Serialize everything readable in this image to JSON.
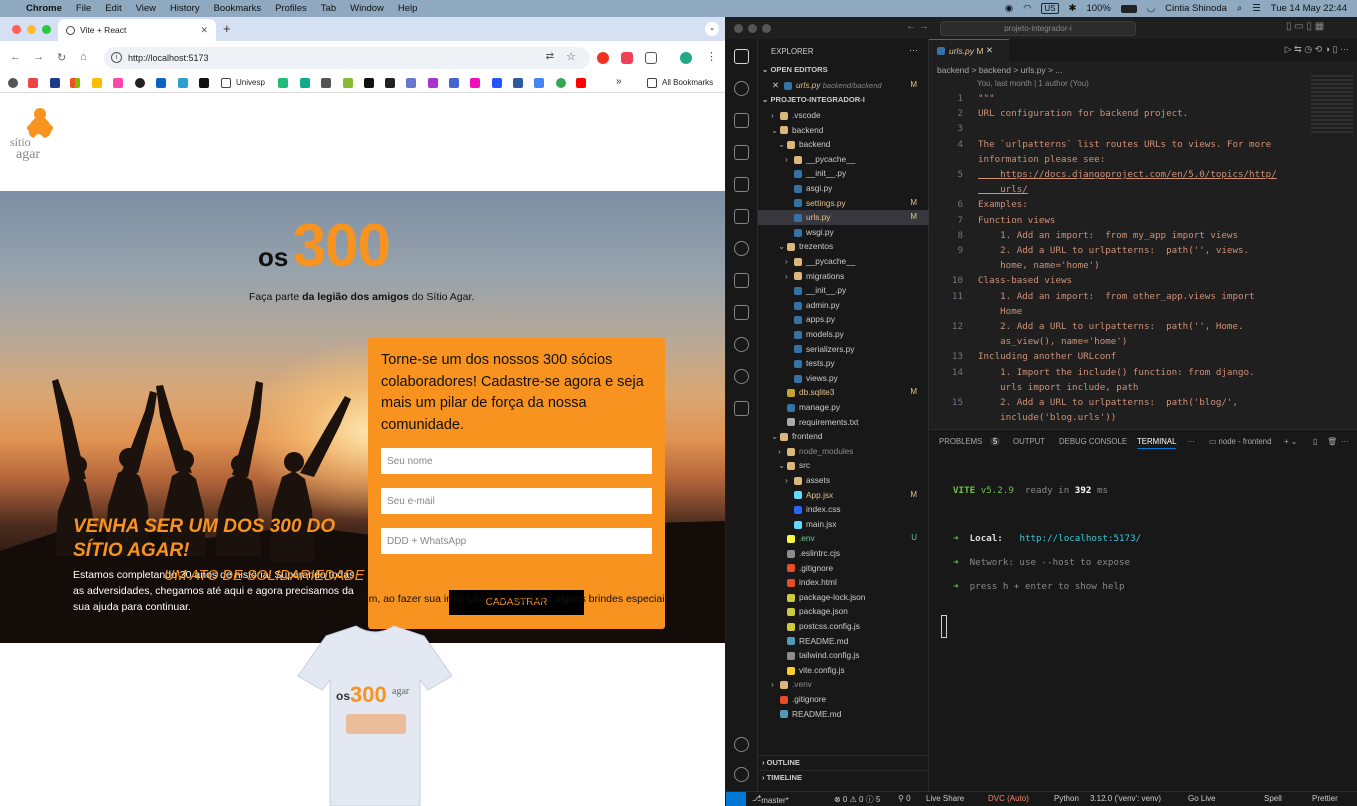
{
  "menubar": {
    "app": "Chrome",
    "items": [
      "File",
      "Edit",
      "View",
      "History",
      "Bookmarks",
      "Profiles",
      "Tab",
      "Window",
      "Help"
    ],
    "right": {
      "battery": "100%",
      "user": "Cintia Shinoda",
      "clock": "Tue 14 May  22:44",
      "input_source": "US"
    }
  },
  "browser": {
    "tab_title": "Vite + React",
    "url": "http://localhost:5173",
    "bookmarks": [
      "Univesp"
    ],
    "all_bookmarks": "All Bookmarks",
    "more": "»"
  },
  "site": {
    "logo_text": "sítio agar",
    "hero_os": "os",
    "hero_300": "300",
    "hero_sub_1": "Faça parte ",
    "hero_sub_bold": "da legião dos amigos",
    "hero_sub_2": " do Sítio Agar.",
    "hero_heading": "VENHA SER UM DOS 300 DO SÍTIO AGAR!",
    "hero_text": "Estamos completando 30 anos de história! Superando todas as adversidades, chegamos até aqui e agora precisamos da sua ajuda para continuar.",
    "form": {
      "title": "Torne-se um dos nossos 300 sócios colaboradores! Cadastre-se agora e seja mais um pilar de força da nossa comunidade.",
      "name_placeholder": "Seu nome",
      "email_placeholder": "Seu e-mail",
      "phone_placeholder": "DDD + WhatsApp",
      "submit": "CADASTRAR"
    },
    "section_title": "UM ATO DE SOLIDARIEDADE QUE RETORNA PARA VOCÊ",
    "section_text": "Como forma de agradecimento por se juntar à nossa corrente do bem, ao fazer sua inscrição você ganhará alguns brindes especiais:",
    "shirt_text_os": "os",
    "shirt_text_300": "300",
    "shirt_text_agar": "agar"
  },
  "vscode": {
    "search": "projeto-integrador-i",
    "explorer_title": "EXPLORER",
    "open_editors": "OPEN EDITORS",
    "open_file": "urls.py",
    "open_file_path": "backend/backend",
    "project": "PROJETO-INTEGRADOR-I",
    "tree": [
      {
        "name": ".vscode",
        "indent": 1,
        "type": "folder",
        "status": "",
        "color": "#cccccc"
      },
      {
        "name": "backend",
        "indent": 1,
        "type": "folder-open",
        "status": "",
        "color": "#cccccc"
      },
      {
        "name": "backend",
        "indent": 2,
        "type": "folder-open",
        "status": "",
        "color": "#cccccc"
      },
      {
        "name": "__pycache__",
        "indent": 3,
        "type": "folder",
        "status": "",
        "color": "#cccccc"
      },
      {
        "name": "__init__.py",
        "indent": 3,
        "type": "py",
        "status": "",
        "color": "#cccccc"
      },
      {
        "name": "asgi.py",
        "indent": 3,
        "type": "py",
        "status": "",
        "color": "#cccccc"
      },
      {
        "name": "settings.py",
        "indent": 3,
        "type": "py",
        "status": "M",
        "color": "#e2c08d"
      },
      {
        "name": "urls.py",
        "indent": 3,
        "type": "py",
        "status": "M",
        "color": "#e2c08d"
      },
      {
        "name": "wsgi.py",
        "indent": 3,
        "type": "py",
        "status": "",
        "color": "#cccccc"
      },
      {
        "name": "trezentos",
        "indent": 2,
        "type": "folder-open",
        "status": "",
        "color": "#cccccc"
      },
      {
        "name": "__pycache__",
        "indent": 3,
        "type": "folder",
        "status": "",
        "color": "#cccccc"
      },
      {
        "name": "migrations",
        "indent": 3,
        "type": "folder",
        "status": "",
        "color": "#cccccc"
      },
      {
        "name": "__init__.py",
        "indent": 3,
        "type": "py",
        "status": "",
        "color": "#cccccc"
      },
      {
        "name": "admin.py",
        "indent": 3,
        "type": "py",
        "status": "",
        "color": "#cccccc"
      },
      {
        "name": "apps.py",
        "indent": 3,
        "type": "py",
        "status": "",
        "color": "#cccccc"
      },
      {
        "name": "models.py",
        "indent": 3,
        "type": "py",
        "status": "",
        "color": "#cccccc"
      },
      {
        "name": "serializers.py",
        "indent": 3,
        "type": "py",
        "status": "",
        "color": "#cccccc"
      },
      {
        "name": "tests.py",
        "indent": 3,
        "type": "py",
        "status": "",
        "color": "#cccccc"
      },
      {
        "name": "views.py",
        "indent": 3,
        "type": "py",
        "status": "",
        "color": "#cccccc"
      },
      {
        "name": "db.sqlite3",
        "indent": 2,
        "type": "db",
        "status": "M",
        "color": "#e2c08d"
      },
      {
        "name": "manage.py",
        "indent": 2,
        "type": "py",
        "status": "",
        "color": "#cccccc"
      },
      {
        "name": "requirements.txt",
        "indent": 2,
        "type": "txt",
        "status": "",
        "color": "#cccccc"
      },
      {
        "name": "frontend",
        "indent": 1,
        "type": "folder-open",
        "status": "",
        "color": "#cccccc"
      },
      {
        "name": "node_modules",
        "indent": 2,
        "type": "folder",
        "status": "",
        "color": "#8c8c8c"
      },
      {
        "name": "src",
        "indent": 2,
        "type": "folder-open",
        "status": "",
        "color": "#cccccc"
      },
      {
        "name": "assets",
        "indent": 3,
        "type": "folder",
        "status": "",
        "color": "#cccccc"
      },
      {
        "name": "App.jsx",
        "indent": 3,
        "type": "jsx",
        "status": "M",
        "color": "#e2c08d"
      },
      {
        "name": "index.css",
        "indent": 3,
        "type": "css",
        "status": "",
        "color": "#cccccc"
      },
      {
        "name": "main.jsx",
        "indent": 3,
        "type": "jsx",
        "status": "",
        "color": "#cccccc"
      },
      {
        "name": ".env",
        "indent": 2,
        "type": "env",
        "status": "U",
        "color": "#73c991"
      },
      {
        "name": ".eslintrc.cjs",
        "indent": 2,
        "type": "cfg",
        "status": "",
        "color": "#cccccc"
      },
      {
        "name": ".gitignore",
        "indent": 2,
        "type": "git",
        "status": "",
        "color": "#cccccc"
      },
      {
        "name": "index.html",
        "indent": 2,
        "type": "html",
        "status": "",
        "color": "#cccccc"
      },
      {
        "name": "package-lock.json",
        "indent": 2,
        "type": "json",
        "status": "",
        "color": "#cccccc"
      },
      {
        "name": "package.json",
        "indent": 2,
        "type": "json",
        "status": "",
        "color": "#cccccc"
      },
      {
        "name": "postcss.config.js",
        "indent": 2,
        "type": "json",
        "status": "",
        "color": "#cccccc"
      },
      {
        "name": "README.md",
        "indent": 2,
        "type": "md",
        "status": "",
        "color": "#cccccc"
      },
      {
        "name": "tailwind.config.js",
        "indent": 2,
        "type": "cfg",
        "status": "",
        "color": "#cccccc"
      },
      {
        "name": "vite.config.js",
        "indent": 2,
        "type": "vite",
        "status": "",
        "color": "#cccccc"
      },
      {
        "name": ".venv",
        "indent": 1,
        "type": "folder",
        "status": "",
        "color": "#8c8c8c"
      },
      {
        "name": ".gitignore",
        "indent": 1,
        "type": "git",
        "status": "",
        "color": "#cccccc"
      },
      {
        "name": "README.md",
        "indent": 1,
        "type": "md",
        "status": "",
        "color": "#cccccc"
      }
    ],
    "outline": "OUTLINE",
    "timeline": "TIMELINE",
    "editor_tab": "urls.py",
    "editor_tab_badge": "M",
    "breadcrumb": "backend  >  backend  >  urls.py  >  ...",
    "blame": "You, last month | 1 author (You)",
    "code": [
      {
        "n": "1",
        "t": "\"\"\""
      },
      {
        "n": "2",
        "t": "URL configuration for backend project."
      },
      {
        "n": "3",
        "t": ""
      },
      {
        "n": "4",
        "t": "The `urlpatterns` list routes URLs to views. For more"
      },
      {
        "n": "",
        "t": "information please see:"
      },
      {
        "n": "5",
        "t": "    https://docs.djangoproject.com/en/5.0/topics/http/"
      },
      {
        "n": "",
        "t": "    urls/"
      },
      {
        "n": "6",
        "t": "Examples:"
      },
      {
        "n": "7",
        "t": "Function views"
      },
      {
        "n": "8",
        "t": "    1. Add an import:  from my_app import views"
      },
      {
        "n": "9",
        "t": "    2. Add a URL to urlpatterns:  path('', views."
      },
      {
        "n": "",
        "t": "    home, name='home')"
      },
      {
        "n": "10",
        "t": "Class-based views"
      },
      {
        "n": "11",
        "t": "    1. Add an import:  from other_app.views import"
      },
      {
        "n": "",
        "t": "    Home"
      },
      {
        "n": "12",
        "t": "    2. Add a URL to urlpatterns:  path('', Home."
      },
      {
        "n": "",
        "t": "    as_view(), name='home')"
      },
      {
        "n": "13",
        "t": "Including another URLconf"
      },
      {
        "n": "14",
        "t": "    1. Import the include() function: from django."
      },
      {
        "n": "",
        "t": "    urls import include, path"
      },
      {
        "n": "15",
        "t": "    2. Add a URL to urlpatterns:  path('blog/',"
      },
      {
        "n": "",
        "t": "    include('blog.urls'))"
      }
    ],
    "panel_tabs": [
      "PROBLEMS",
      "5",
      "OUTPUT",
      "DEBUG CONSOLE",
      "TERMINAL"
    ],
    "terminal_name": "node - frontend",
    "terminal": {
      "vite": "VITE",
      "version": "v5.2.9",
      "ready": "ready in",
      "ms": "392",
      "ms_unit": "ms",
      "local_label": "Local:",
      "local_url": "http://localhost:5173/",
      "network": "Network: use --host to expose",
      "help": "press h + enter to show help"
    },
    "status": {
      "branch": "master*",
      "errors": "⊗ 0 ⚠ 0 ⓘ 5",
      "ports": "⚲ 0",
      "live_share": "Live Share",
      "dvc": "DVC (Auto)",
      "lang": "Python",
      "interpreter": "3.12.0 ('venv': venv)",
      "golive": "Go Live",
      "spell": "Spell",
      "prettier": "Prettier"
    }
  }
}
